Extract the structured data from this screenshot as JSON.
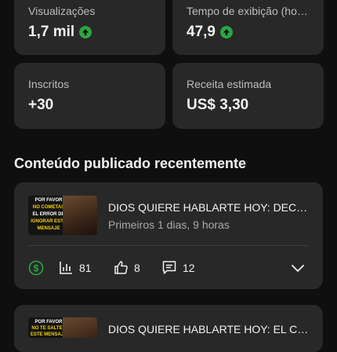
{
  "stats": [
    {
      "label": "Visualizações",
      "value": "1,7 mil",
      "trend": "up"
    },
    {
      "label": "Tempo de exibição (horas)",
      "value": "47,9",
      "trend": "up"
    },
    {
      "label": "Inscritos",
      "value": "+30"
    },
    {
      "label": "Receita estimada",
      "value": "US$ 3,30"
    }
  ],
  "section_title": "Conteúdo publicado recentemente",
  "videos": [
    {
      "thumb_lines": [
        "POR FAVOR",
        "NO COMETAS",
        "EL ERROR DE",
        "IGNORAR ESTE",
        "MENSAJE"
      ],
      "title": "DIOS QUIERE HABLARTE HOY: DECIDE HOY",
      "subtitle": "Primeiros 1 dias, 9 horas",
      "views": "81",
      "likes": "8",
      "comments": "12"
    },
    {
      "thumb_lines": [
        "POR FAVOR",
        "NO TE SALTES",
        "ESTE MENSAJE"
      ],
      "title": "DIOS QUIERE HABLARTE HOY: EL CAMINO"
    }
  ],
  "colors": {
    "background": "#0f0f0f",
    "card": "#282828",
    "trend_up": "#2ba640",
    "thumb_accent": "#f5d000"
  }
}
